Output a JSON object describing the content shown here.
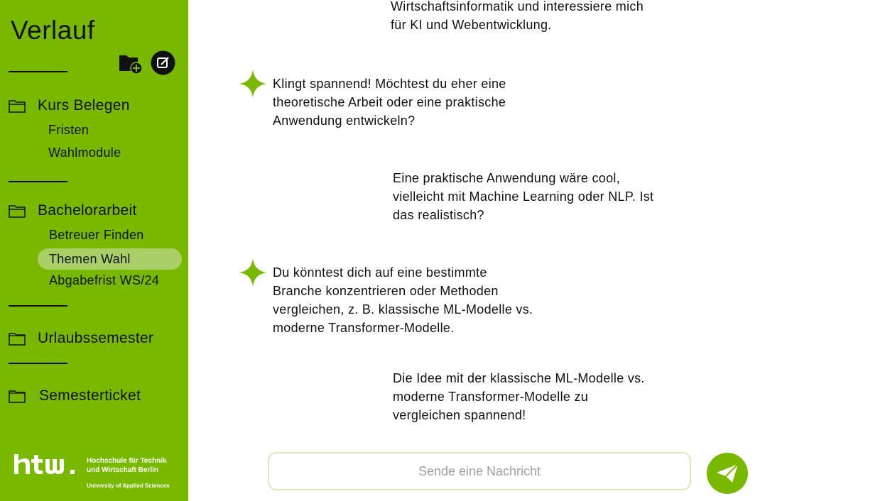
{
  "sidebar": {
    "title": "Verlauf",
    "actions": {
      "new_folder_icon": "folder-plus-icon",
      "new_chat_icon": "edit-icon"
    },
    "folders": [
      {
        "label": "Kurs Belegen",
        "items": [
          "Fristen",
          "Wahlmodule"
        ]
      },
      {
        "label": "Bachelorarbeit",
        "items": [
          "Betreuer  Finden",
          "Themen Wahl",
          "Abgabefrist WS/24"
        ],
        "active_item": "Themen Wahl"
      },
      {
        "label": "Urlaubssemester",
        "items": []
      },
      {
        "label": "Semesterticket",
        "items": []
      }
    ],
    "logo": {
      "wordmark": "htw.",
      "line1": "Hochschule für Technik",
      "line2": "und Wirtschaft Berlin",
      "line3": "University of Applied Sciences"
    }
  },
  "chat": {
    "messages": [
      {
        "role": "user",
        "lines": [
          "Wirtschaftsinformatik und interessiere mich",
          "für KI und Webentwicklung."
        ]
      },
      {
        "role": "assistant",
        "lines": [
          "Klingt spannend! Möchtest du eher eine",
          "theoretische Arbeit oder eine praktische",
          "Anwendung entwickeln?"
        ]
      },
      {
        "role": "user",
        "lines": [
          "Eine praktische Anwendung wäre cool,",
          "vielleicht mit Machine Learning oder NLP. Ist",
          "das realistisch?"
        ]
      },
      {
        "role": "assistant",
        "lines": [
          "Du könntest dich auf eine bestimmte",
          "Branche konzentrieren oder Methoden",
          "vergleichen, z. B. klassische ML-Modelle vs.",
          "moderne Transformer-Modelle."
        ]
      },
      {
        "role": "user",
        "lines": [
          "Die Idee mit der klassische ML-Modelle vs.",
          "moderne Transformer-Modelle zu",
          "vergleichen spannend!"
        ]
      }
    ],
    "assistant_icon": "sparkle-icon",
    "input": {
      "placeholder": "Sende eine Nachricht",
      "value": ""
    },
    "send_icon": "send-icon"
  },
  "colors": {
    "brand_green": "#78b900",
    "active_highlight": "#a9cf66",
    "input_border": "#d8e9b6"
  }
}
